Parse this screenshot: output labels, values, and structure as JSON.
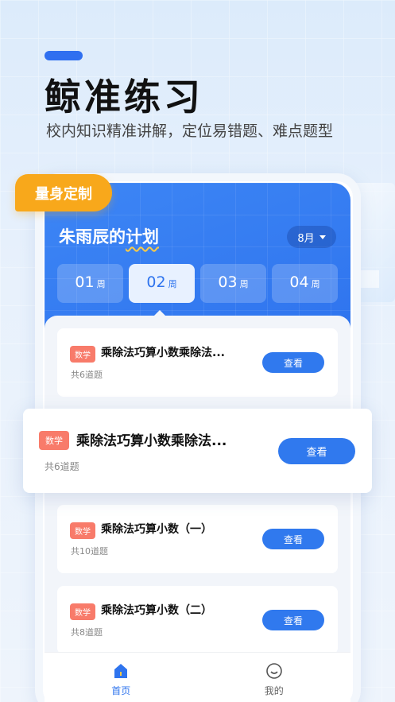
{
  "promo": {
    "headline": "鲸准练习",
    "subline": "校内知识精准讲解，定位易错题、难点题型",
    "badge": "量身定制"
  },
  "plan": {
    "name_prefix": "朱雨辰的",
    "name_highlight": "计划",
    "month": "8月"
  },
  "weeks": [
    {
      "num": "01",
      "unit": "周"
    },
    {
      "num": "02",
      "unit": "周"
    },
    {
      "num": "03",
      "unit": "周"
    },
    {
      "num": "04",
      "unit": "周"
    }
  ],
  "tasks": [
    {
      "tag": "数学",
      "title": "乘除法巧算小数乘除法...",
      "count": "共6道题",
      "button": "查看"
    },
    {
      "tag": "数学",
      "title": "乘除法巧算小数乘除法...",
      "count": "共6道题",
      "button": "查看"
    },
    {
      "tag": "数学",
      "title": "乘除法巧算小数（一）",
      "count": "共10道题",
      "button": "查看"
    },
    {
      "tag": "数学",
      "title": "乘除法巧算小数（二）",
      "count": "共8道题",
      "button": "查看"
    }
  ],
  "tabs": [
    {
      "label": "首页",
      "icon": "home-icon"
    },
    {
      "label": "我的",
      "icon": "smile-icon"
    }
  ],
  "colors": {
    "accent": "#2f74ee",
    "tag": "#f87b6a",
    "badge": "#f8a81b"
  }
}
